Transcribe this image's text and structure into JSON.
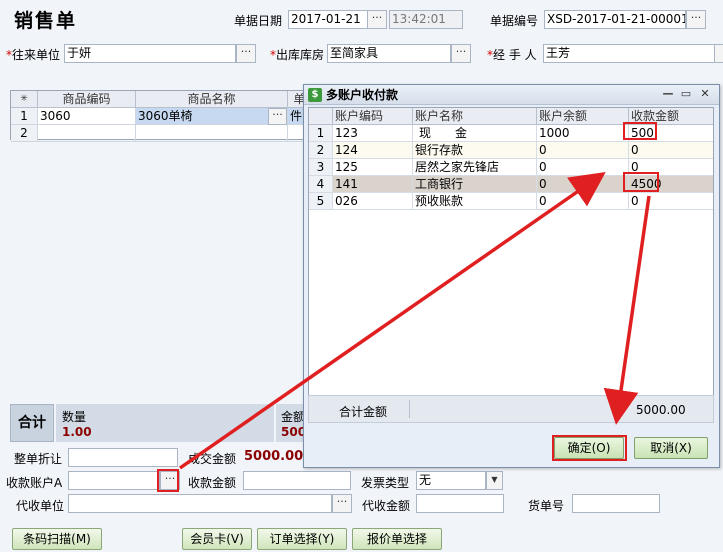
{
  "header": {
    "title": "销售单",
    "date_label": "单据日期",
    "date_value": "2017-01-21",
    "time_value": "13:42:01",
    "docno_label": "单据编号",
    "docno_value": "XSD-2017-01-21-00001"
  },
  "form": {
    "customer_label": "往来单位",
    "customer_value": "于妍",
    "warehouse_label": "出库库房",
    "warehouse_value": "至简家具",
    "handler_label": "经 手 人",
    "handler_value": "王芳",
    "required_mark": "*"
  },
  "main_grid": {
    "headers": [
      "商品编码",
      "商品名称",
      "单"
    ],
    "rows": [
      {
        "num": "1",
        "code": "3060",
        "name": "3060单椅",
        "unit": "件"
      },
      {
        "num": "2",
        "code": "",
        "name": "",
        "unit": ""
      }
    ],
    "corner_glyph": "✳"
  },
  "dialog": {
    "title": "多账户收付款",
    "columns": [
      "账户编码",
      "账户名称",
      "账户余额",
      "收款金额"
    ],
    "rows": [
      {
        "num": "1",
        "code": "123",
        "name": "现　　金",
        "balance": "1000",
        "amount": "500"
      },
      {
        "num": "2",
        "code": "124",
        "name": "银行存款",
        "balance": "0",
        "amount": "0"
      },
      {
        "num": "3",
        "code": "125",
        "name": "居然之家先锋店",
        "balance": "0",
        "amount": "0"
      },
      {
        "num": "4",
        "code": "141",
        "name": "工商银行",
        "balance": "0",
        "amount": "4500"
      },
      {
        "num": "5",
        "code": "026",
        "name": "预收账款",
        "balance": "0",
        "amount": "0"
      }
    ],
    "sum_label": "合计金额",
    "sum_value": "5000.00",
    "ok_label": "确定(O)",
    "cancel_label": "取消(X)"
  },
  "totals": {
    "label": "合计",
    "qty_label": "数量",
    "qty_value": "1.00",
    "amount_label": "金额",
    "amount_value": "500"
  },
  "bottom": {
    "discount_label": "整单折让",
    "deal_label": "成交金额",
    "deal_value": "5000.00",
    "account_label": "收款账户A",
    "receive_label": "收款金额",
    "invoice_label": "发票类型",
    "invoice_value": "无",
    "agent_label": "代收单位",
    "agent_amount_label": "代收金额",
    "waybill_label": "货单号"
  },
  "buttons": {
    "barcode": "条码扫描(M)",
    "member": "会员卡(V)",
    "order": "订单选择(Y)",
    "quote": "报价单选择"
  },
  "colors": {
    "highlight_red": "#e02020",
    "dark_red_value": "#8b0000"
  }
}
